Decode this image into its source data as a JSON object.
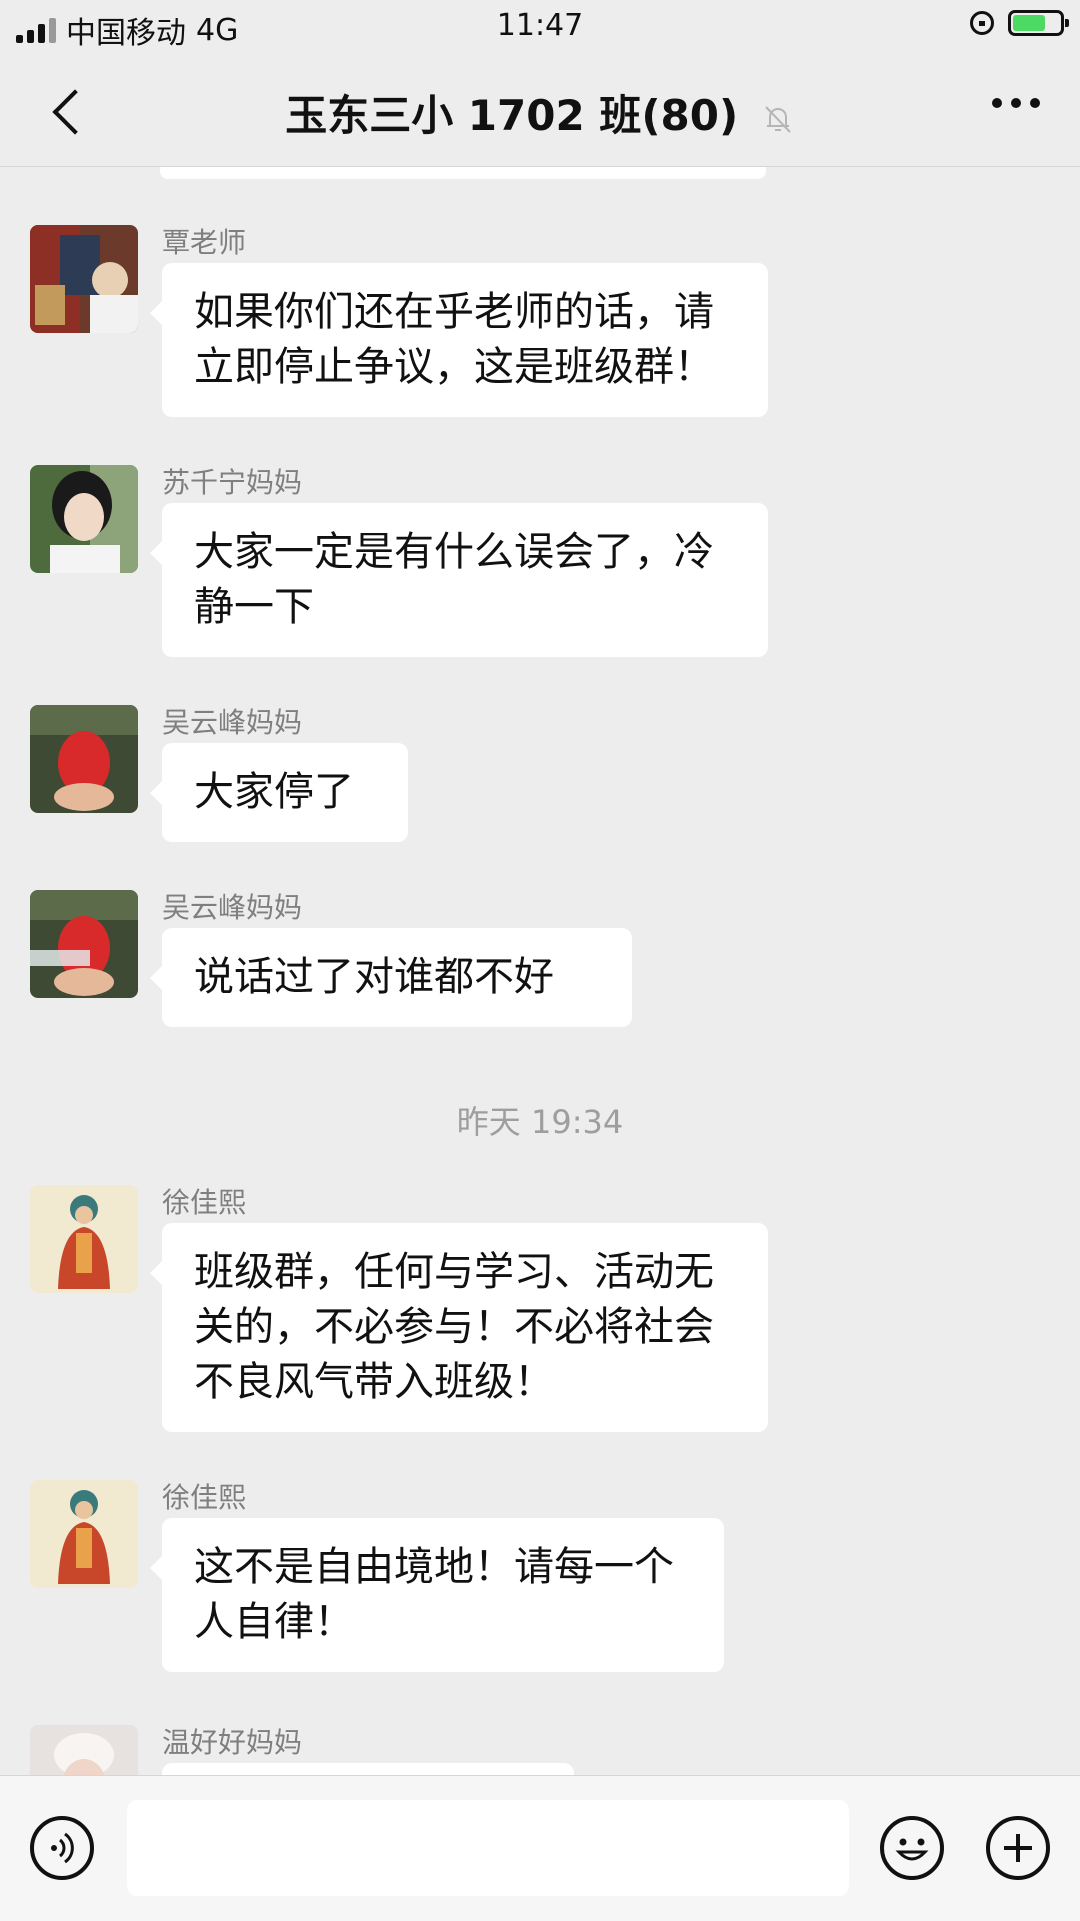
{
  "status_bar": {
    "carrier": "中国移动",
    "network": "4G",
    "time": "11:47"
  },
  "nav": {
    "title": "玉东三小 1702 班(80)",
    "back_icon": "chevron-left-icon",
    "mute_icon": "bell-muted-icon",
    "more_icon": "more-dots-icon"
  },
  "messages": [
    {
      "sender": "覃老师",
      "text": "如果你们还在乎老师的话，请立即停止争议，这是班级群！"
    },
    {
      "sender": "苏千宁妈妈",
      "text": "大家一定是有什么误会了，冷静一下"
    },
    {
      "sender": "吴云峰妈妈",
      "text": "大家停了"
    },
    {
      "sender": "吴云峰妈妈",
      "text": "说话过了对谁都不好"
    },
    {
      "sender": "徐佳熙",
      "text": "班级群，任何与学习、活动无关的，不必参与！不必将社会不良风气带入班级！"
    },
    {
      "sender": "徐佳熙",
      "text": "这不是自由境地！请每一个人自律！"
    },
    {
      "sender": "温好好妈妈",
      "text": ""
    }
  ],
  "timestamp": "昨天 19:34",
  "input_bar": {
    "voice_icon": "voice-icon",
    "emoji_icon": "emoji-icon",
    "plus_icon": "plus-icon",
    "placeholder": ""
  },
  "colors": {
    "background": "#ededed",
    "bubble": "#ffffff",
    "sender_name": "#7f7f7f",
    "battery_fill": "#4cd964"
  }
}
